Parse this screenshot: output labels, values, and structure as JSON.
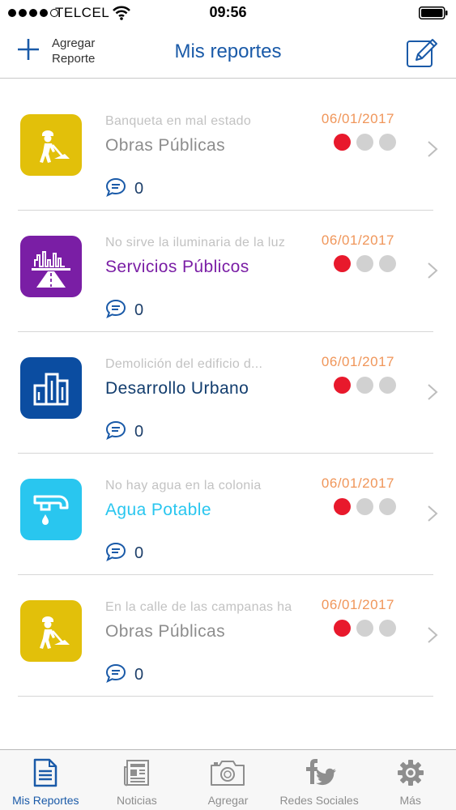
{
  "status_bar": {
    "carrier": "TELCEL",
    "time": "09:56"
  },
  "nav": {
    "add_label_line1": "Agregar",
    "add_label_line2": "Reporte",
    "title": "Mis reportes"
  },
  "colors": {
    "accent": "#1a5aa8",
    "obras": "#e2c00a",
    "servicios": "#7a1ea5",
    "desarrollo": "#0b4da1",
    "agua": "#29c6ef",
    "date": "#f0965a",
    "status_active": "#e8192c",
    "status_inactive": "#d1d1d1"
  },
  "reports": [
    {
      "description": "Banqueta en mal estado",
      "category": "Obras Públicas",
      "date": "06/01/2017",
      "comments": "0",
      "icon": "worker-shovel-icon",
      "active_status": 1
    },
    {
      "description": "No sirve la iluminaria de la luz",
      "category": "Servicios Públicos",
      "date": "06/01/2017",
      "comments": "0",
      "icon": "city-road-icon",
      "active_status": 1
    },
    {
      "description": "Demolición del edificio d...",
      "category": "Desarrollo Urbano",
      "date": "06/01/2017",
      "comments": "0",
      "icon": "buildings-icon",
      "active_status": 1
    },
    {
      "description": "No hay agua en la colonia",
      "category": "Agua Potable",
      "date": "06/01/2017",
      "comments": "0",
      "icon": "faucet-icon",
      "active_status": 1
    },
    {
      "description": "En la calle de las campanas ha...",
      "category": "Obras Públicas",
      "date": "06/01/2017",
      "comments": "0",
      "icon": "worker-shovel-icon",
      "active_status": 1
    }
  ],
  "tabs": [
    {
      "label": "Mis Reportes",
      "icon": "document-icon",
      "active": true
    },
    {
      "label": "Noticias",
      "icon": "newspaper-icon",
      "active": false
    },
    {
      "label": "Agregar",
      "icon": "camera-icon",
      "active": false
    },
    {
      "label": "Redes Sociales",
      "icon": "facebook-twitter-icon",
      "active": false
    },
    {
      "label": "Más",
      "icon": "gear-icon",
      "active": false
    }
  ]
}
